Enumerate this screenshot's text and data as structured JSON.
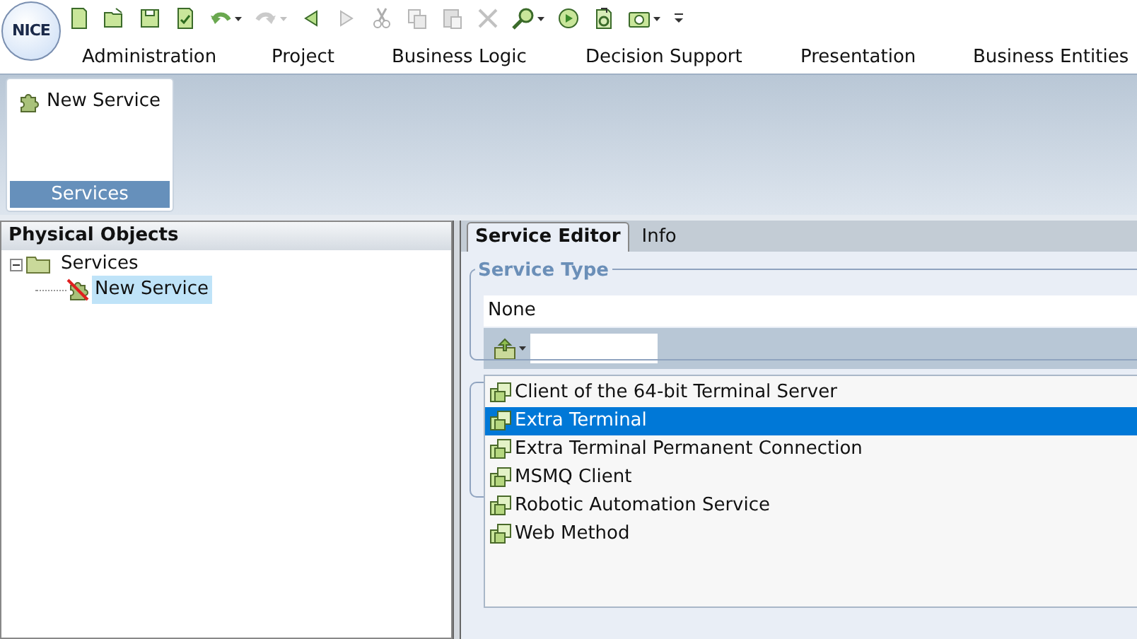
{
  "logo": {
    "text": "NICE"
  },
  "toolbar": [
    {
      "kind": "new",
      "disabled": false,
      "dropdown": false
    },
    {
      "kind": "open",
      "disabled": false,
      "dropdown": false
    },
    {
      "kind": "save",
      "disabled": false,
      "dropdown": false
    },
    {
      "kind": "check",
      "disabled": false,
      "dropdown": false
    },
    {
      "kind": "undo",
      "disabled": false,
      "dropdown": true
    },
    {
      "kind": "redo",
      "disabled": true,
      "dropdown": true
    },
    {
      "kind": "back",
      "disabled": false,
      "dropdown": false
    },
    {
      "kind": "forward",
      "disabled": true,
      "dropdown": false
    },
    {
      "kind": "cut",
      "disabled": true,
      "dropdown": false
    },
    {
      "kind": "copy",
      "disabled": true,
      "dropdown": false
    },
    {
      "kind": "paste",
      "disabled": true,
      "dropdown": false
    },
    {
      "kind": "delete",
      "disabled": true,
      "dropdown": false
    },
    {
      "kind": "find",
      "disabled": false,
      "dropdown": true
    },
    {
      "kind": "run",
      "disabled": false,
      "dropdown": false
    },
    {
      "kind": "export",
      "disabled": false,
      "dropdown": false
    },
    {
      "kind": "camera",
      "disabled": false,
      "dropdown": true
    },
    {
      "kind": "overflow",
      "disabled": false,
      "dropdown": false
    }
  ],
  "menu": [
    {
      "label": "Administration",
      "selected": false
    },
    {
      "label": "Project",
      "selected": false
    },
    {
      "label": "Business Logic",
      "selected": false
    },
    {
      "label": "Decision Support",
      "selected": false
    },
    {
      "label": "Presentation",
      "selected": false
    },
    {
      "label": "Business Entities",
      "selected": false
    }
  ],
  "ribbon": {
    "item": "New Service",
    "group": "Services"
  },
  "physical_objects": {
    "title": "Physical Objects",
    "tree": [
      {
        "label": "Services",
        "expanded": true,
        "selected": false,
        "children": [
          {
            "label": "New Service",
            "selected": true
          }
        ]
      }
    ]
  },
  "editor": {
    "tabs": [
      {
        "label": "Service Editor",
        "selected": true
      },
      {
        "label": "Info",
        "selected": false
      }
    ],
    "service_type": {
      "legend": "Service Type",
      "value": "None"
    },
    "types": [
      {
        "label": "Client of the 64-bit Terminal Server",
        "selected": false
      },
      {
        "label": "Extra Terminal",
        "selected": true
      },
      {
        "label": "Extra Terminal Permanent Connection",
        "selected": false
      },
      {
        "label": "MSMQ Client",
        "selected": false
      },
      {
        "label": "Robotic Automation Service",
        "selected": false
      },
      {
        "label": "Web Method",
        "selected": false
      }
    ]
  }
}
